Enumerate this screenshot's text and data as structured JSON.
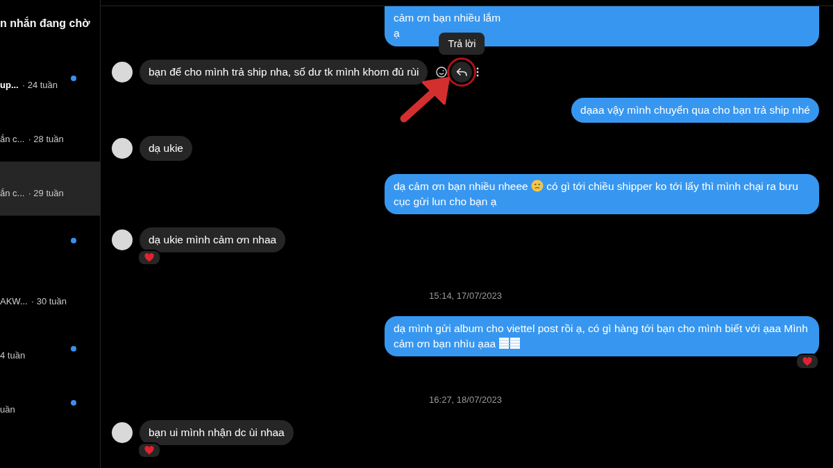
{
  "sidebar": {
    "title": "n nhắn đang chờ",
    "items": [
      {
        "preview": "up...",
        "time": "· 24 tuần",
        "unread": true,
        "selected": false
      },
      {
        "preview": "ắn c...",
        "time": "· 28 tuần",
        "unread": false,
        "selected": false
      },
      {
        "preview": "ắn c...",
        "time": "· 29 tuần",
        "unread": false,
        "selected": true
      },
      {
        "unread": true,
        "selected": false
      },
      {
        "preview": "AKW...",
        "time": "· 30 tuần",
        "unread": false,
        "selected": false
      },
      {
        "time": "4 tuần",
        "unread": true,
        "selected": false
      },
      {
        "time": "uần",
        "unread": true,
        "selected": false
      }
    ]
  },
  "chat": {
    "items": [
      {
        "kind": "outgoing",
        "parts": [
          {
            "kind": "text",
            "text": "cảm ơn bạn nhiều lắm\nạ"
          }
        ],
        "reaction": false
      },
      {
        "kind": "incoming",
        "parts": [
          {
            "kind": "text",
            "text": "bạn để cho mình trả ship nha, số dư tk mình khom đủ rùi"
          }
        ],
        "reaction": false,
        "hovered": true,
        "tooltip": "Trả lời",
        "highlight": true
      },
      {
        "kind": "outgoing",
        "parts": [
          {
            "kind": "text",
            "text": "dạaa vậy mình chuyển qua cho bạn trả ship nhé"
          }
        ],
        "reaction": false
      },
      {
        "kind": "incoming",
        "parts": [
          {
            "kind": "text",
            "text": "dạ ukie"
          }
        ],
        "reaction": false,
        "hovered": false
      },
      {
        "kind": "outgoing",
        "parts": [
          {
            "kind": "text",
            "text": "dạ cảm ơn bạn nhiều nheee "
          },
          {
            "kind": "emoji"
          },
          {
            "kind": "text",
            "text": " có gì tới chiều shipper ko tới lấy thì mình chại ra bưu cục gửi lun cho bạn ạ"
          }
        ],
        "reaction": false
      },
      {
        "kind": "incoming",
        "parts": [
          {
            "kind": "text",
            "text": "dạ ukie mình cảm ơn nhaa"
          }
        ],
        "reaction": true,
        "hovered": false
      },
      {
        "kind": "timestamp",
        "text": "15:14, 17/07/2023"
      },
      {
        "kind": "outgoing",
        "parts": [
          {
            "kind": "text",
            "text": "dạ mình gửi album cho viettel post rồi ạ, có gì hàng tới bạn cho mình biết với ạaa Mình cảm ơn bạn nhìu ạaa "
          },
          {
            "kind": "grid"
          }
        ],
        "reaction": true
      },
      {
        "kind": "timestamp",
        "text": "16:27, 18/07/2023"
      },
      {
        "kind": "incoming",
        "parts": [
          {
            "kind": "text",
            "text": "bạn ui mình nhận dc ùi nhaa"
          }
        ],
        "reaction": true,
        "hovered": false
      }
    ]
  }
}
